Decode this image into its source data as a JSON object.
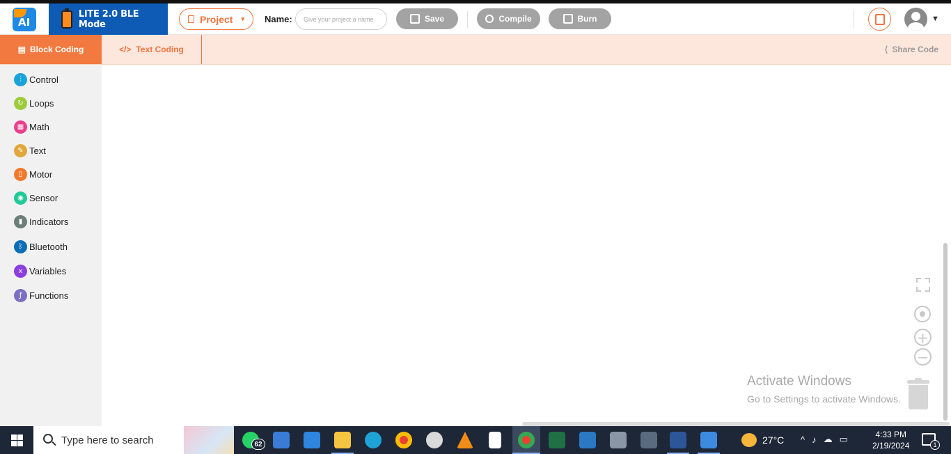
{
  "header": {
    "logo_text": "AI",
    "mode_label": "LITE 2.0 BLE Mode",
    "project_label": "Project",
    "name_label": "Name:",
    "name_placeholder": "Give your project a name",
    "save_label": "Save",
    "compile_label": "Compile",
    "burn_label": "Burn"
  },
  "tabs": {
    "block_coding": "Block Coding",
    "text_coding": "Text Coding",
    "share_code": "Share Code"
  },
  "categories": [
    {
      "label": "Control",
      "color": "#1aa3d9"
    },
    {
      "label": "Loops",
      "color": "#9ccc3c"
    },
    {
      "label": "Math",
      "color": "#e83e8c"
    },
    {
      "label": "Text",
      "color": "#e0a83a"
    },
    {
      "label": "Motor",
      "color": "#f07a2c"
    },
    {
      "label": "Sensor",
      "color": "#20c997"
    },
    {
      "label": "Indicators",
      "color": "#6b7f79"
    },
    {
      "label": "Bluetooth",
      "color": "#0b6db5"
    },
    {
      "label": "Variables",
      "color": "#8b3fe0"
    },
    {
      "label": "Functions",
      "color": "#7a6fc4"
    }
  ],
  "watermark": {
    "line1": "Activate Windows",
    "line2": "Go to Settings to activate Windows."
  },
  "taskbar": {
    "search_placeholder": "Type here to search",
    "whatsapp_badge": "62",
    "weather": "27°C",
    "time": "4:33 PM",
    "date": "2/19/2024",
    "notifications": "1"
  }
}
